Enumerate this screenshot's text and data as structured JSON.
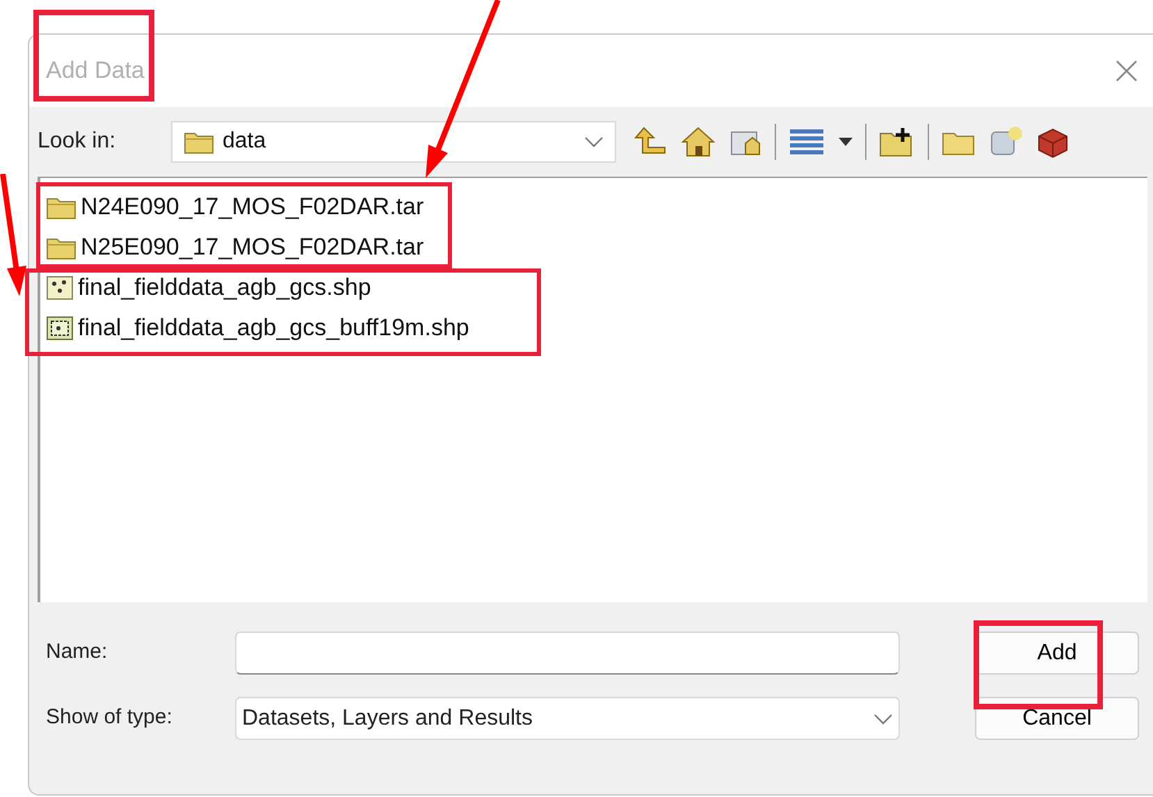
{
  "window": {
    "title": "Add Data"
  },
  "look_in": {
    "label": "Look in:",
    "value": "data"
  },
  "files": [
    {
      "name": "N24E090_17_MOS_F02DAR.tar",
      "kind": "folder",
      "selected": false
    },
    {
      "name": "N25E090_17_MOS_F02DAR.tar",
      "kind": "folder",
      "selected": false
    },
    {
      "name": "final_fielddata_agb_gcs.shp",
      "kind": "points",
      "selected": false
    },
    {
      "name": "final_fielddata_agb_gcs_buff19m.shp",
      "kind": "polygons",
      "selected": false
    }
  ],
  "name_field": {
    "label": "Name:"
  },
  "type_field": {
    "label": "Show of type:",
    "value": "Datasets, Layers and Results"
  },
  "buttons": [
    "Add",
    "Cancel"
  ]
}
